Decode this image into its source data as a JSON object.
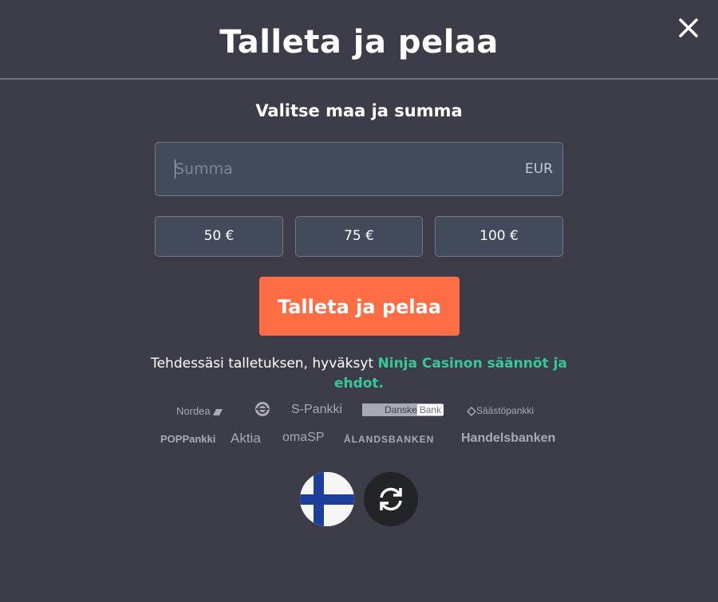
{
  "header": {
    "title": "Talleta ja pelaa",
    "close_icon": "close-icon"
  },
  "form": {
    "subtitle": "Valitse maa ja summa",
    "amount_placeholder": "Summa",
    "amount_value": "",
    "currency": "EUR",
    "presets": [
      "50 €",
      "75 €",
      "100 €"
    ],
    "submit_label": "Talleta ja pelaa"
  },
  "terms": {
    "text": "Tehdessäsi talletuksen, hyväksyt ",
    "link_text": "Ninja Casinon säännöt ja ehdot."
  },
  "banks": {
    "row1": [
      "Nordea",
      "",
      "S-Pankki",
      "Danske",
      "Bank",
      "Säästöpankki"
    ],
    "row2": [
      "POPPankki",
      "Aktia",
      "omaSP",
      "ÅLANDSBANKEN",
      "Handelsbanken"
    ]
  },
  "country": {
    "flag_icon": "finland-flag-icon",
    "refresh_icon": "refresh-icon"
  },
  "colors": {
    "background": "#3c3d49",
    "accent": "#ff6d45",
    "link": "#35c998"
  }
}
